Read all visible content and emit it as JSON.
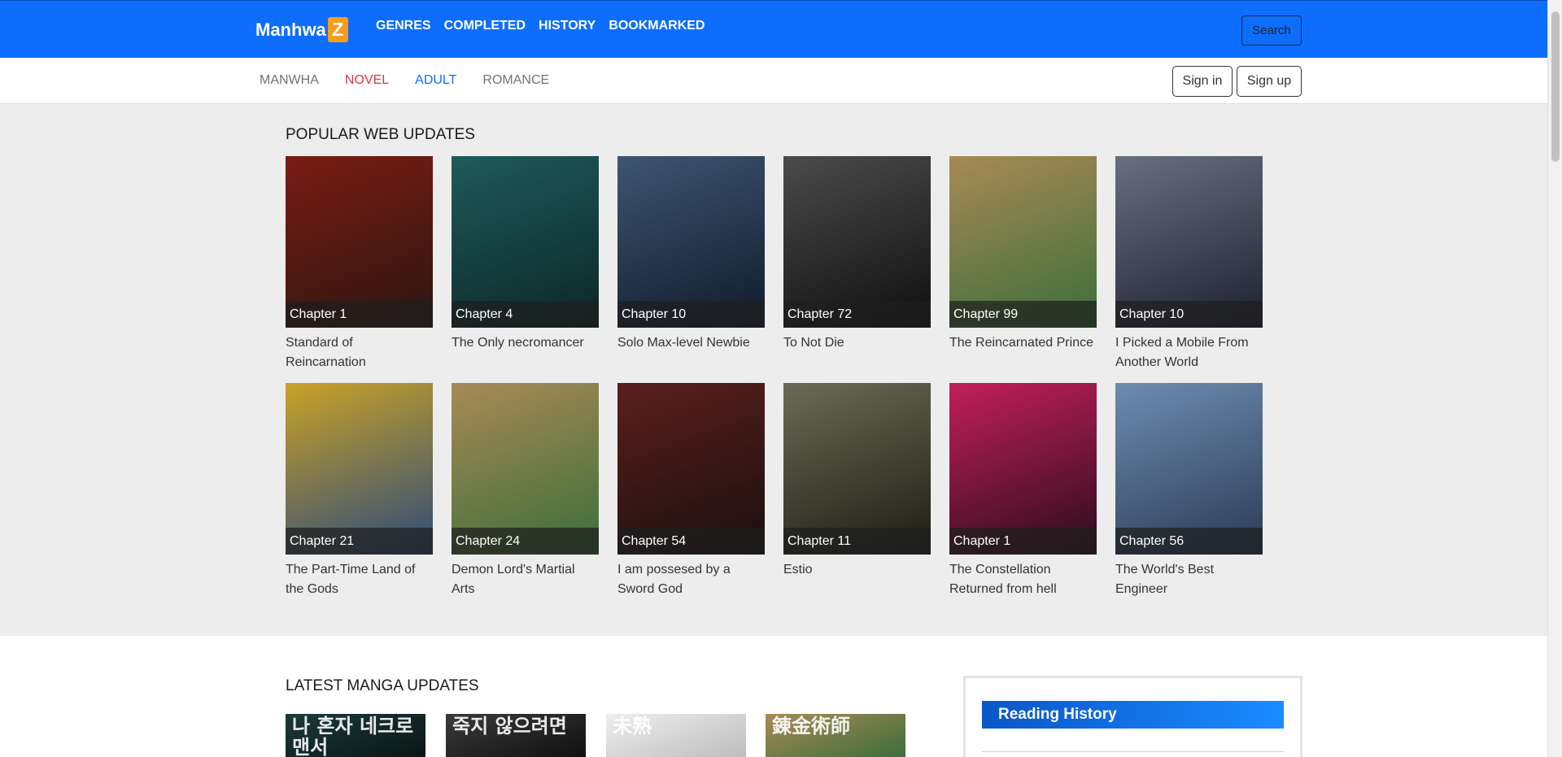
{
  "brand": {
    "name": "Manhwa",
    "badge": "Z",
    "badge_color": "#f89c1c",
    "primary_color": "#0d6efd"
  },
  "topnav": [
    "GENRES",
    "COMPLETED",
    "HISTORY",
    "BOOKMARKED"
  ],
  "search": {
    "label": "Search"
  },
  "subnav": [
    "MANWHA",
    "NOVEL",
    "ADULT",
    "ROMANCE"
  ],
  "auth": {
    "signin": "Sign in",
    "signup": "Sign up"
  },
  "popular": {
    "title": "POPULAR WEB UPDATES",
    "items": [
      {
        "chapter": "Chapter 1",
        "title": "Standard of Reincarnation",
        "colors": [
          "#7a1d14",
          "#2a1610"
        ]
      },
      {
        "chapter": "Chapter 4",
        "title": "The Only necromancer",
        "colors": [
          "#1f5a5a",
          "#0d2626"
        ]
      },
      {
        "chapter": "Chapter 10",
        "title": "Solo Max-level Newbie",
        "colors": [
          "#3e5572",
          "#101a2b"
        ]
      },
      {
        "chapter": "Chapter 72",
        "title": "To Not Die",
        "colors": [
          "#4b4b4b",
          "#0f0f0f"
        ]
      },
      {
        "chapter": "Chapter 99",
        "title": "The Reincarnated Prince",
        "colors": [
          "#a88a55",
          "#3b6e3b"
        ]
      },
      {
        "chapter": "Chapter 10",
        "title": "I Picked a Mobile From Another World",
        "colors": [
          "#6a6f80",
          "#1d2030"
        ]
      },
      {
        "chapter": "Chapter 21",
        "title": "The Part-Time Land of the Gods",
        "colors": [
          "#c9a227",
          "#2c4a7a"
        ]
      },
      {
        "chapter": "Chapter 24",
        "title": "Demon Lord's Martial Arts",
        "colors": [
          "#a88a55",
          "#3b6e3b"
        ]
      },
      {
        "chapter": "Chapter 54",
        "title": "I am possesed by a Sword God",
        "colors": [
          "#5a1f1f",
          "#1a0f0f"
        ]
      },
      {
        "chapter": "Chapter 11",
        "title": "Estio",
        "colors": [
          "#6b6b55",
          "#1c1c16"
        ]
      },
      {
        "chapter": "Chapter 1",
        "title": "The Constellation Returned from hell",
        "colors": [
          "#c21f5a",
          "#2a0d1a"
        ]
      },
      {
        "chapter": "Chapter 56",
        "title": "The World's Best Engineer",
        "colors": [
          "#6d8cb0",
          "#2b3b55"
        ]
      }
    ]
  },
  "latest": {
    "title": "LATEST MANGA UPDATES",
    "items": [
      {
        "colors": [
          "#1a3a3a",
          "#0b1515"
        ],
        "cover_text": "나 혼자 네크로맨서"
      },
      {
        "colors": [
          "#3a3a3a",
          "#101010"
        ],
        "cover_text": "죽지 않으려면"
      },
      {
        "colors": [
          "#eeeeee",
          "#bdbdbd"
        ],
        "cover_text": "未熟"
      },
      {
        "colors": [
          "#a88a55",
          "#3b6e3b"
        ],
        "cover_text": "錬金術師"
      }
    ]
  },
  "history": {
    "title": "Reading History"
  }
}
